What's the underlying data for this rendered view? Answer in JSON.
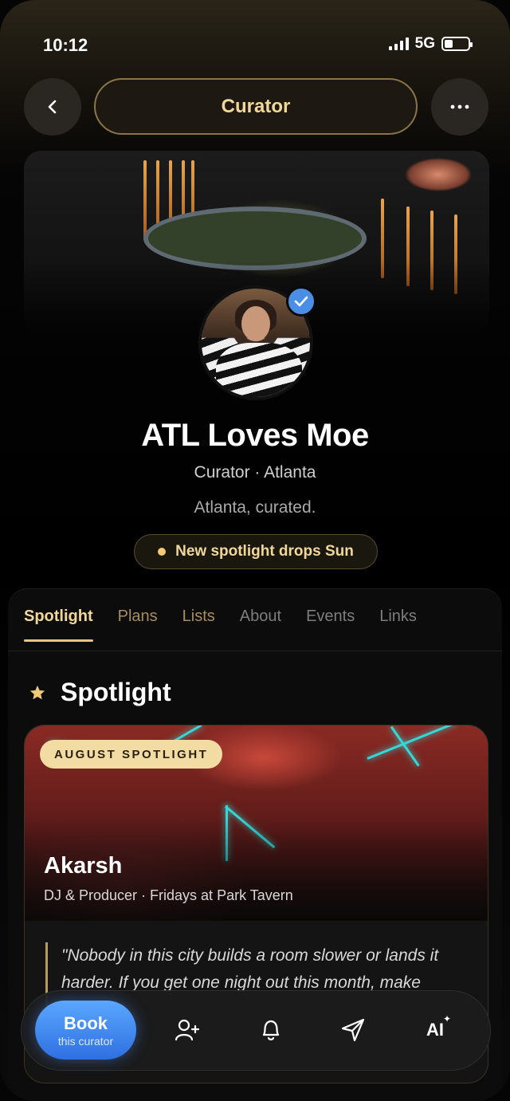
{
  "status_bar": {
    "time": "10:12",
    "network": "5G",
    "battery_level": 0.35
  },
  "nav": {
    "title": "Curator",
    "back_icon": "chevron-left-icon",
    "more_icon": "ellipsis-icon"
  },
  "profile": {
    "name": "ATL Loves Moe",
    "subtitle": "Curator · Atlanta",
    "tagline": "Atlanta, curated.",
    "verified": true,
    "announcement": "New spotlight drops Sun"
  },
  "tabs": [
    {
      "label": "Spotlight",
      "active": true
    },
    {
      "label": "Plans"
    },
    {
      "label": "Lists"
    },
    {
      "label": "About"
    },
    {
      "label": "Events"
    },
    {
      "label": "Links"
    }
  ],
  "section": {
    "title": "Spotlight",
    "icon": "star-icon"
  },
  "spotlight_card": {
    "badge": "AUGUST SPOTLIGHT",
    "artist": "Akarsh",
    "details": "DJ & Producer · Fridays at Park Tavern",
    "quote": "\"Nobody in this city builds a room slower or lands it harder. If you get one night out this month, make"
  },
  "bottom_bar": {
    "book_label": "Book",
    "book_sublabel": "this curator",
    "ai_label": "AI",
    "icons": [
      "add-person-icon",
      "bell-icon",
      "send-icon",
      "ai-sparkle-icon"
    ]
  },
  "colors": {
    "accent_gold": "#f1d89a",
    "book_blue": "#3f86f0",
    "verified_blue": "#4a8ee6"
  }
}
